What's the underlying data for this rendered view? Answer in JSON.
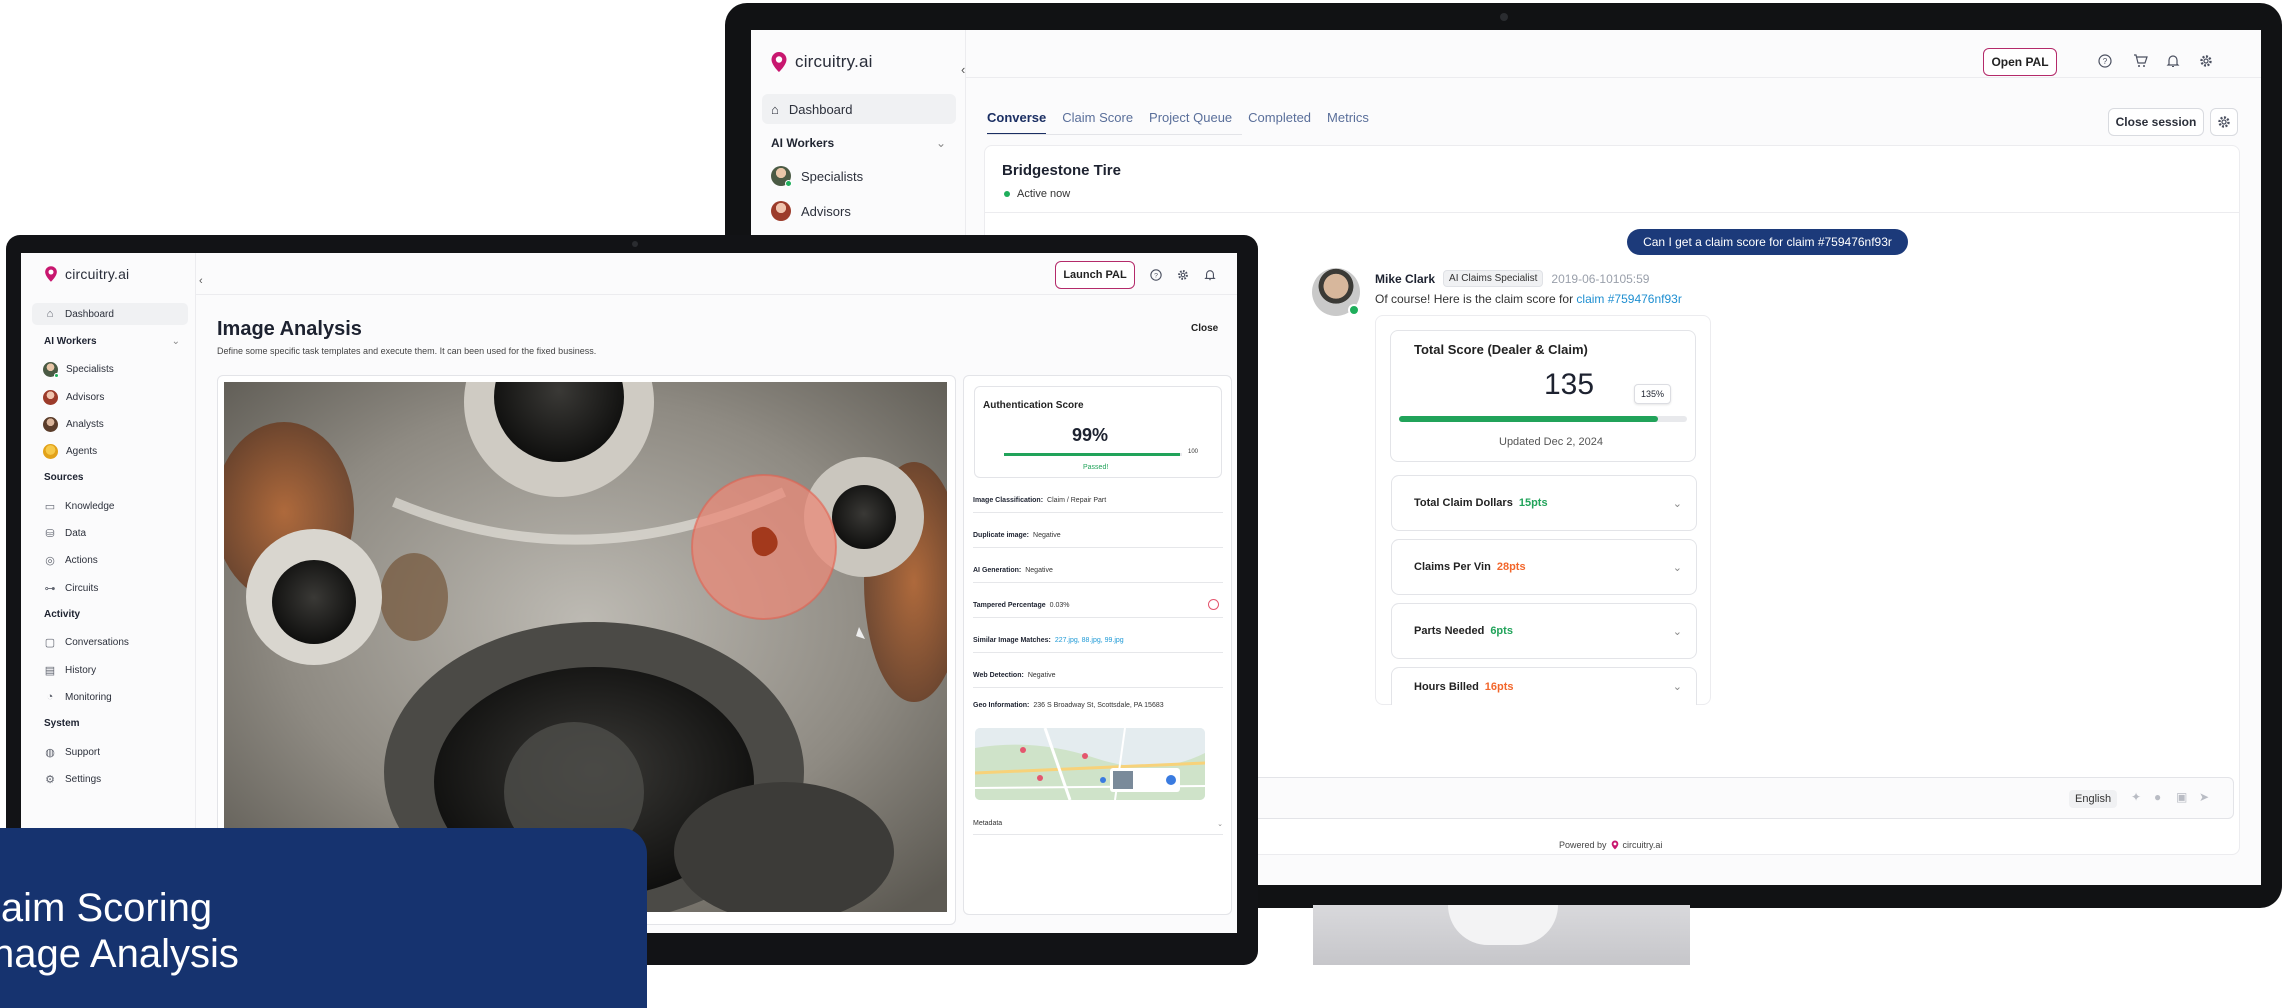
{
  "colors": {
    "brand_pink": "#c8176f",
    "navy": "#16336f",
    "accent_blue": "#1c3a7a",
    "green": "#21a35a",
    "orange": "#f2662b",
    "red": "#e4566e",
    "link": "#1f9ad6"
  },
  "brand": {
    "name": "circuitry.ai"
  },
  "back_window": {
    "sidebar": {
      "dashboard": "Dashboard",
      "ai_workers": "AI Workers",
      "specialists": "Specialists",
      "advisors": "Advisors"
    },
    "header": {
      "open_pal": "Open PAL",
      "icons": [
        "help-icon",
        "cart-icon",
        "bell-icon",
        "gear-icon"
      ]
    },
    "tabs": [
      "Converse",
      "Claim Score",
      "Project Queue",
      "Completed",
      "Metrics"
    ],
    "close_session": "Close session",
    "conversation": {
      "company": "Bridgestone Tire",
      "status": "Active now",
      "user_message": "Can I get a claim score for claim #759476nf93r",
      "agent": {
        "name": "Mike Clark",
        "role": "AI Claims Specialist",
        "timestamp": "2019-06-10105:59"
      },
      "agent_message": "Of course! Here is the claim score for ",
      "agent_link": "claim #759476nf93r",
      "score": {
        "title": "Total Score (Dealer & Claim)",
        "value": "135",
        "percent_badge": "135%",
        "progress_fraction": 0.9,
        "updated": "Updated Dec 2, 2024"
      },
      "score_rows": [
        {
          "label": "Total Claim Dollars",
          "points": "15pts",
          "color": "#21a35a"
        },
        {
          "label": "Claims Per Vin",
          "points": "28pts",
          "color": "#f2662b"
        },
        {
          "label": "Parts Needed",
          "points": "6pts",
          "color": "#21a35a"
        },
        {
          "label": "Hours Billed",
          "points": "16pts",
          "color": "#f2662b"
        }
      ]
    },
    "input": {
      "language": "English"
    },
    "footer": {
      "powered_by": "Powered by",
      "brand": "circuitry.ai"
    }
  },
  "front_window": {
    "sidebar": {
      "dashboard": "Dashboard",
      "ai_workers": "AI Workers",
      "workers": [
        "Specialists",
        "Advisors",
        "Analysts",
        "Agents"
      ],
      "sources_heading": "Sources",
      "sources": [
        "Knowledge",
        "Data",
        "Actions",
        "Circuits"
      ],
      "activity_heading": "Activity",
      "activity": [
        "Conversations",
        "History",
        "Monitoring"
      ],
      "system_heading": "System",
      "system": [
        "Support",
        "Settings"
      ]
    },
    "header": {
      "launch_pal": "Launch PAL"
    },
    "page": {
      "title": "Image Analysis",
      "subtitle": "Define some specific task templates and execute them. It can been used for the fixed business.",
      "close": "Close"
    },
    "auth": {
      "title": "Authentication Score",
      "value": "99%",
      "max": "100",
      "status": "Passed!",
      "progress_fraction": 0.99
    },
    "details": [
      {
        "label": "Image Classification:",
        "value": "Claim / Repair Part"
      },
      {
        "label": "Duplicate image:",
        "value": "Negative"
      },
      {
        "label": "AI Generation:",
        "value": "Negative"
      },
      {
        "label": "Tampered Percentage",
        "value": "0.03%"
      },
      {
        "label": "Similar Image Matches:",
        "value": "227.jpg, 88.jpg, 99.jpg"
      },
      {
        "label": "Web Detection:",
        "value": "Negative"
      },
      {
        "label": "Geo Information:",
        "value": "236 S Broadway St, Scottsdale, PA 15683"
      }
    ],
    "metadata": "Metadata"
  },
  "banner": {
    "line1": "laim Scoring",
    "line2": "nage Analysis"
  }
}
